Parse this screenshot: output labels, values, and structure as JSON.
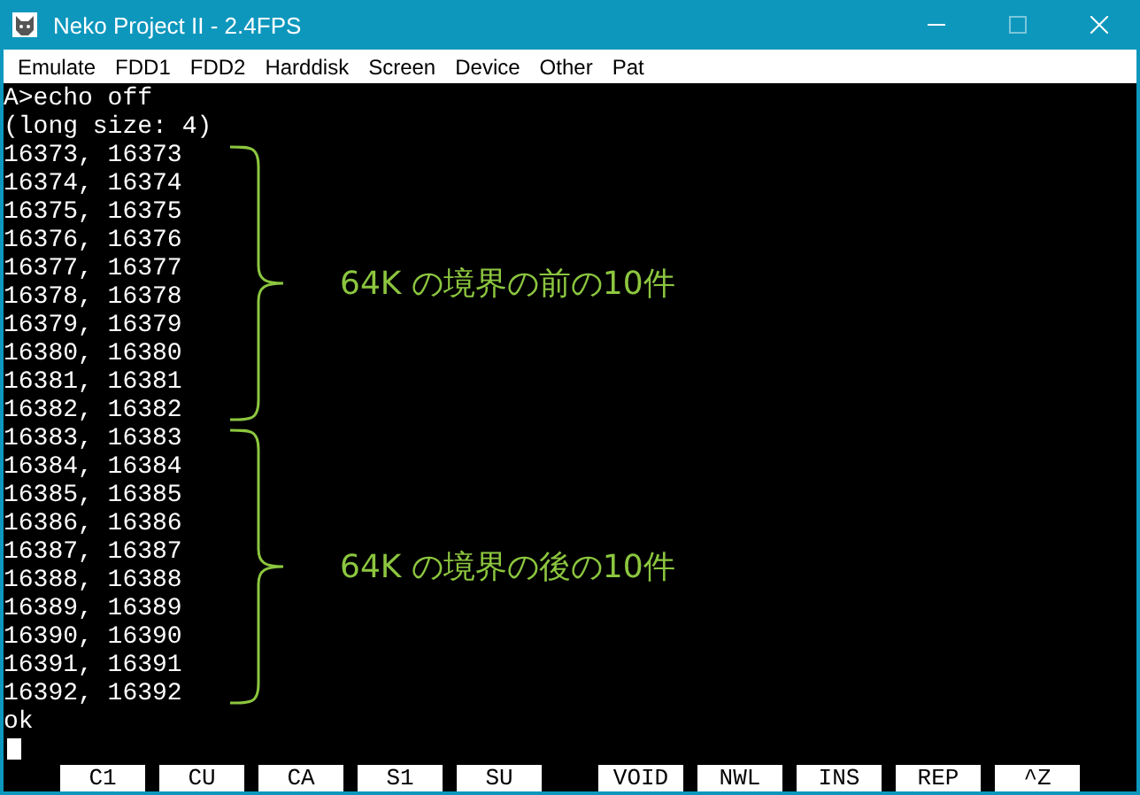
{
  "window": {
    "title": "Neko Project II - 2.4FPS",
    "maximize_disabled": true
  },
  "menu": [
    "Emulate",
    "FDD1",
    "FDD2",
    "Harddisk",
    "Screen",
    "Device",
    "Other",
    "Pat"
  ],
  "terminal": {
    "header_lines": [
      "A>echo off",
      "(long size: 4)"
    ],
    "groups": [
      {
        "annotation": "64K の境界の前の10件",
        "lines": [
          "16373, 16373",
          "16374, 16374",
          "16375, 16375",
          "16376, 16376",
          "16377, 16377",
          "16378, 16378",
          "16379, 16379",
          "16380, 16380",
          "16381, 16381",
          "16382, 16382"
        ]
      },
      {
        "annotation": "64K の境界の後の10件",
        "lines": [
          "16383, 16383",
          "16384, 16384",
          "16385, 16385",
          "16386, 16386",
          "16387, 16387",
          "16388, 16388",
          "16389, 16389",
          "16390, 16390",
          "16391, 16391",
          "16392, 16392"
        ]
      }
    ],
    "footer_lines": [
      "ok"
    ],
    "cursor": true
  },
  "function_keys": [
    [
      "C1",
      "CU",
      "CA",
      "S1",
      "SU"
    ],
    [
      "VOID",
      "NWL",
      "INS",
      "REP",
      "^Z"
    ]
  ]
}
